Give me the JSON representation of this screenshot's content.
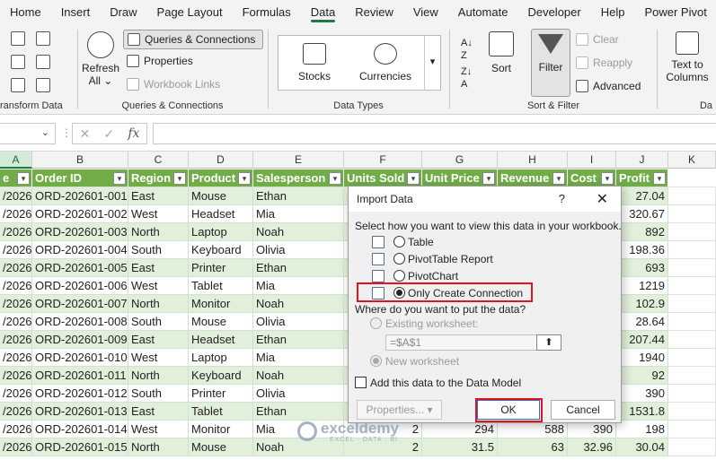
{
  "tabs": [
    "Home",
    "Insert",
    "Draw",
    "Page Layout",
    "Formulas",
    "Data",
    "Review",
    "View",
    "Automate",
    "Developer",
    "Help",
    "Power Pivot"
  ],
  "active_tab": "Data",
  "ribbon": {
    "transform_data_label": "ransform Data",
    "refresh_all_line1": "Refresh",
    "refresh_all_line2": "All",
    "queries_connections": "Queries & Connections",
    "properties": "Properties",
    "workbook_links": "Workbook Links",
    "queries_group_label": "Queries & Connections",
    "stocks": "Stocks",
    "currencies": "Currencies",
    "data_types_label": "Data Types",
    "sort": "Sort",
    "filter": "Filter",
    "clear": "Clear",
    "reapply": "Reapply",
    "advanced": "Advanced",
    "sort_filter_label": "Sort & Filter",
    "text_to_columns_line1": "Text to",
    "text_to_columns_line2": "Columns",
    "data_tools_label": "Da"
  },
  "formula_bar": {
    "fx": "fx",
    "cancel": "✕",
    "enter": "✓",
    "value": ""
  },
  "columns": [
    "A",
    "B",
    "C",
    "D",
    "E",
    "F",
    "G",
    "H",
    "I",
    "J",
    "K"
  ],
  "table": {
    "headers": [
      "e",
      "Order ID",
      "Region",
      "Product",
      "Salesperson",
      "Units Sold",
      "Unit Price",
      "Revenue",
      "Cost",
      "Profit"
    ],
    "rows": [
      [
        "/2026",
        "ORD-202601-001",
        "East",
        "Mouse",
        "Ethan",
        "",
        "",
        "",
        "",
        "27.04"
      ],
      [
        "/2026",
        "ORD-202601-002",
        "West",
        "Headset",
        "Mia",
        "",
        "",
        "",
        "",
        "320.67"
      ],
      [
        "/2026",
        "ORD-202601-003",
        "North",
        "Laptop",
        "Noah",
        "",
        "",
        "",
        "",
        "892"
      ],
      [
        "/2026",
        "ORD-202601-004",
        "South",
        "Keyboard",
        "Olivia",
        "",
        "",
        "",
        "",
        "198.36"
      ],
      [
        "/2026",
        "ORD-202601-005",
        "East",
        "Printer",
        "Ethan",
        "",
        "",
        "",
        "",
        "693"
      ],
      [
        "/2026",
        "ORD-202601-006",
        "West",
        "Tablet",
        "Mia",
        "",
        "",
        "",
        "",
        "1219"
      ],
      [
        "/2026",
        "ORD-202601-007",
        "North",
        "Monitor",
        "Noah",
        "",
        "",
        "",
        "",
        "102.9"
      ],
      [
        "/2026",
        "ORD-202601-008",
        "South",
        "Mouse",
        "Olivia",
        "",
        "",
        "",
        "",
        "28.64"
      ],
      [
        "/2026",
        "ORD-202601-009",
        "East",
        "Headset",
        "Ethan",
        "",
        "",
        "",
        "",
        "207.44"
      ],
      [
        "/2026",
        "ORD-202601-010",
        "West",
        "Laptop",
        "Mia",
        "",
        "",
        "",
        "",
        "1940"
      ],
      [
        "/2026",
        "ORD-202601-011",
        "North",
        "Keyboard",
        "Noah",
        "",
        "",
        "",
        "",
        "92"
      ],
      [
        "/2026",
        "ORD-202601-012",
        "South",
        "Printer",
        "Olivia",
        "",
        "",
        "",
        "",
        "390"
      ],
      [
        "/2026",
        "ORD-202601-013",
        "East",
        "Tablet",
        "Ethan",
        "",
        "",
        "",
        "",
        "1531.8"
      ],
      [
        "/2026",
        "ORD-202601-014",
        "West",
        "Monitor",
        "Mia",
        "2",
        "294",
        "588",
        "390",
        "198"
      ],
      [
        "/2026",
        "ORD-202601-015",
        "North",
        "Mouse",
        "Noah",
        "2",
        "31.5",
        "63",
        "32.96",
        "30.04"
      ]
    ]
  },
  "dialog": {
    "title": "Import Data",
    "help": "?",
    "close": "✕",
    "view_prompt": "Select how you want to view this data in your workbook.",
    "options": [
      "Table",
      "PivotTable Report",
      "PivotChart",
      "Only Create Connection"
    ],
    "selected_option": "Only Create Connection",
    "put_prompt": "Where do you want to put the data?",
    "existing_worksheet": "Existing worksheet:",
    "reference": "=$A$1",
    "new_worksheet": "New worksheet",
    "data_model": "Add this data to the Data Model",
    "properties_button": "Properties...",
    "ok_button": "OK",
    "cancel_button": "Cancel"
  },
  "watermark": {
    "name": "exceldemy",
    "tagline": "EXCEL · DATA · BI"
  },
  "colors": {
    "header_green": "#70ad47",
    "band_green": "#e2efda",
    "accent": "#1f7a44",
    "highlight_red": "#e0141e"
  }
}
